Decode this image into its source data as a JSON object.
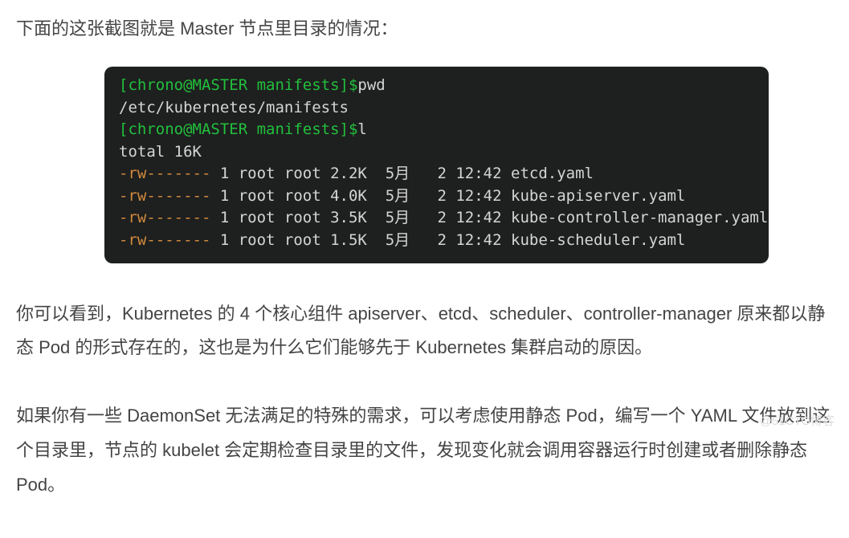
{
  "intro": "下面的这张截图就是 Master 节点里目录的情况：",
  "terminal": {
    "prompt1": "[chrono@MASTER manifests]$",
    "cmd1": "pwd",
    "out1": "/etc/kubernetes/manifests",
    "prompt2": "[chrono@MASTER manifests]$",
    "cmd2": "l",
    "total": "total 16K",
    "rows": [
      {
        "perm": "-rw-------",
        "rest": " 1 root root 2.2K  5月   2 12:42 etcd.yaml"
      },
      {
        "perm": "-rw-------",
        "rest": " 1 root root 4.0K  5月   2 12:42 kube-apiserver.yaml"
      },
      {
        "perm": "-rw-------",
        "rest": " 1 root root 3.5K  5月   2 12:42 kube-controller-manager.yaml"
      },
      {
        "perm": "-rw-------",
        "rest": " 1 root root 1.5K  5月   2 12:42 kube-scheduler.yaml"
      }
    ]
  },
  "para1": "你可以看到，Kubernetes 的 4 个核心组件 apiserver、etcd、scheduler、controller-manager 原来都以静态 Pod 的形式存在的，这也是为什么它们能够先于 Kubernetes 集群启动的原因。",
  "para2": "如果你有一些 DaemonSet 无法满足的特殊的需求，可以考虑使用静态 Pod，编写一个 YAML 文件放到这个目录里，节点的 kubelet 会定期检查目录里的文件，发现变化就会调用容器运行时创建或者删除静态 Pod。",
  "watermark": "@51CTO博客"
}
